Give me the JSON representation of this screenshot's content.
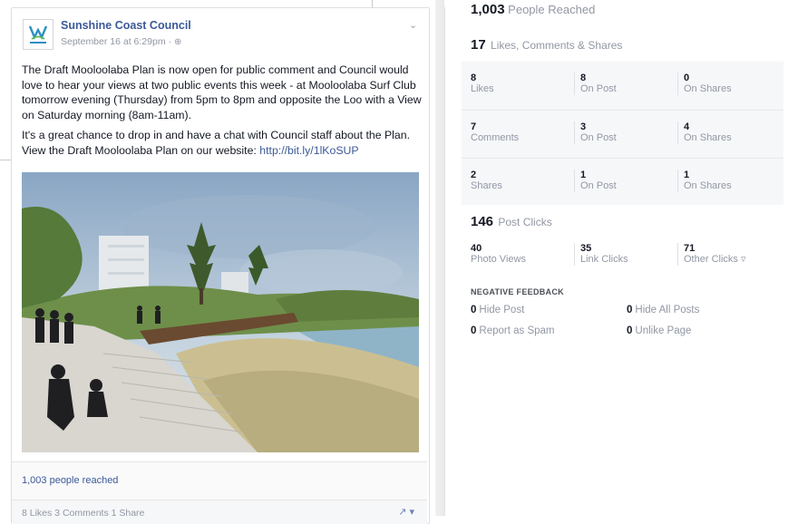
{
  "post": {
    "page_name": "Sunshine Coast Council",
    "meta": "September 16 at 6:29pm ·",
    "paragraph1": "The Draft Mooloolaba Plan is now open for public comment and Council would love to hear your views at two public events this week - at Mooloolaba Surf Club tomorrow evening (Thursday) from 5pm to 8pm and opposite the Loo with a View on Saturday morning (8am-11am).",
    "paragraph2": "It's a great chance to drop in and have a chat with Council staff about the Plan. View the Draft Mooloolaba Plan on our website: ",
    "link": "http://bit.ly/1lKoSUP",
    "reach": "1,003 people reached",
    "footer_counts": "8 Likes  3 Comments  1 Share"
  },
  "insights": {
    "reached_number": "1,003",
    "reached_label": "People Reached",
    "engagement": {
      "number": "17",
      "label": "Likes, Comments & Shares"
    },
    "rows": [
      [
        {
          "num": "8",
          "label": "Likes"
        },
        {
          "num": "8",
          "label": "On Post"
        },
        {
          "num": "0",
          "label": "On Shares"
        }
      ],
      [
        {
          "num": "7",
          "label": "Comments"
        },
        {
          "num": "3",
          "label": "On Post"
        },
        {
          "num": "4",
          "label": "On Shares"
        }
      ],
      [
        {
          "num": "2",
          "label": "Shares"
        },
        {
          "num": "1",
          "label": "On Post"
        },
        {
          "num": "1",
          "label": "On Shares"
        }
      ]
    ],
    "post_clicks": {
      "number": "146",
      "label": "Post Clicks"
    },
    "clicks": [
      {
        "num": "40",
        "label": "Photo Views"
      },
      {
        "num": "35",
        "label": "Link Clicks"
      },
      {
        "num": "71",
        "label": "Other Clicks"
      }
    ],
    "negative": {
      "title": "NEGATIVE FEEDBACK",
      "items": [
        {
          "num": "0",
          "label": "Hide Post"
        },
        {
          "num": "0",
          "label": "Hide All Posts"
        },
        {
          "num": "0",
          "label": "Report as Spam"
        },
        {
          "num": "0",
          "label": "Unlike Page"
        }
      ]
    }
  },
  "icons": {
    "globe": "globe-icon",
    "chevron": "chevron-down-icon",
    "info": "info-icon",
    "share": "share-icon"
  }
}
